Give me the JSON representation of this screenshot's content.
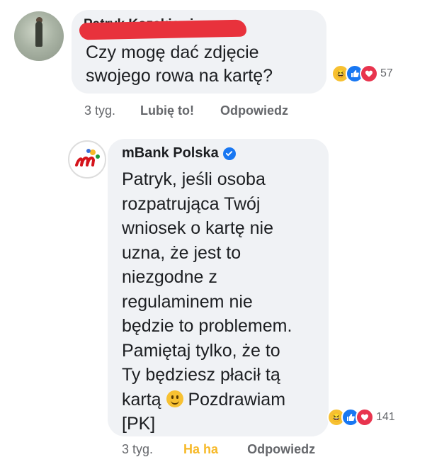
{
  "comment1": {
    "author_name": "Patryk Kozakiewicz",
    "text": "Czy mogę dać zdjęcie\nswojego rowa na kartę?",
    "reactions": [
      "haha",
      "like",
      "love"
    ],
    "reaction_count": "57",
    "meta": {
      "time": "3 tyg.",
      "like_label": "Lubię to!",
      "reply_label": "Odpowiedz"
    }
  },
  "comment2": {
    "author_name": "mBank Polska",
    "verified": true,
    "text_before_emoji": "Patryk, jeśli osoba\nrozpatrująca Twój\nwniosek o kartę nie\nuzna, że jest to\nniezgodne z\nregulaminem nie\nbędzie to problemem.\nPamiętaj tylko, że to\nTy będziesz płacił tą\nkartą ",
    "emoji": "smiling-face",
    "text_after_emoji": " Pozdrawiam\n[PK]",
    "reactions": [
      "haha",
      "like",
      "love"
    ],
    "reaction_count": "141",
    "meta": {
      "time": "3 tyg.",
      "like_label": "Ha ha",
      "reply_label": "Odpowiedz"
    }
  },
  "colors": {
    "bubble": "#f0f2f5",
    "redaction": "#e8323c",
    "meta": "#65676b",
    "haha_active": "#f7b928",
    "mbank_red": "#d5141c"
  }
}
